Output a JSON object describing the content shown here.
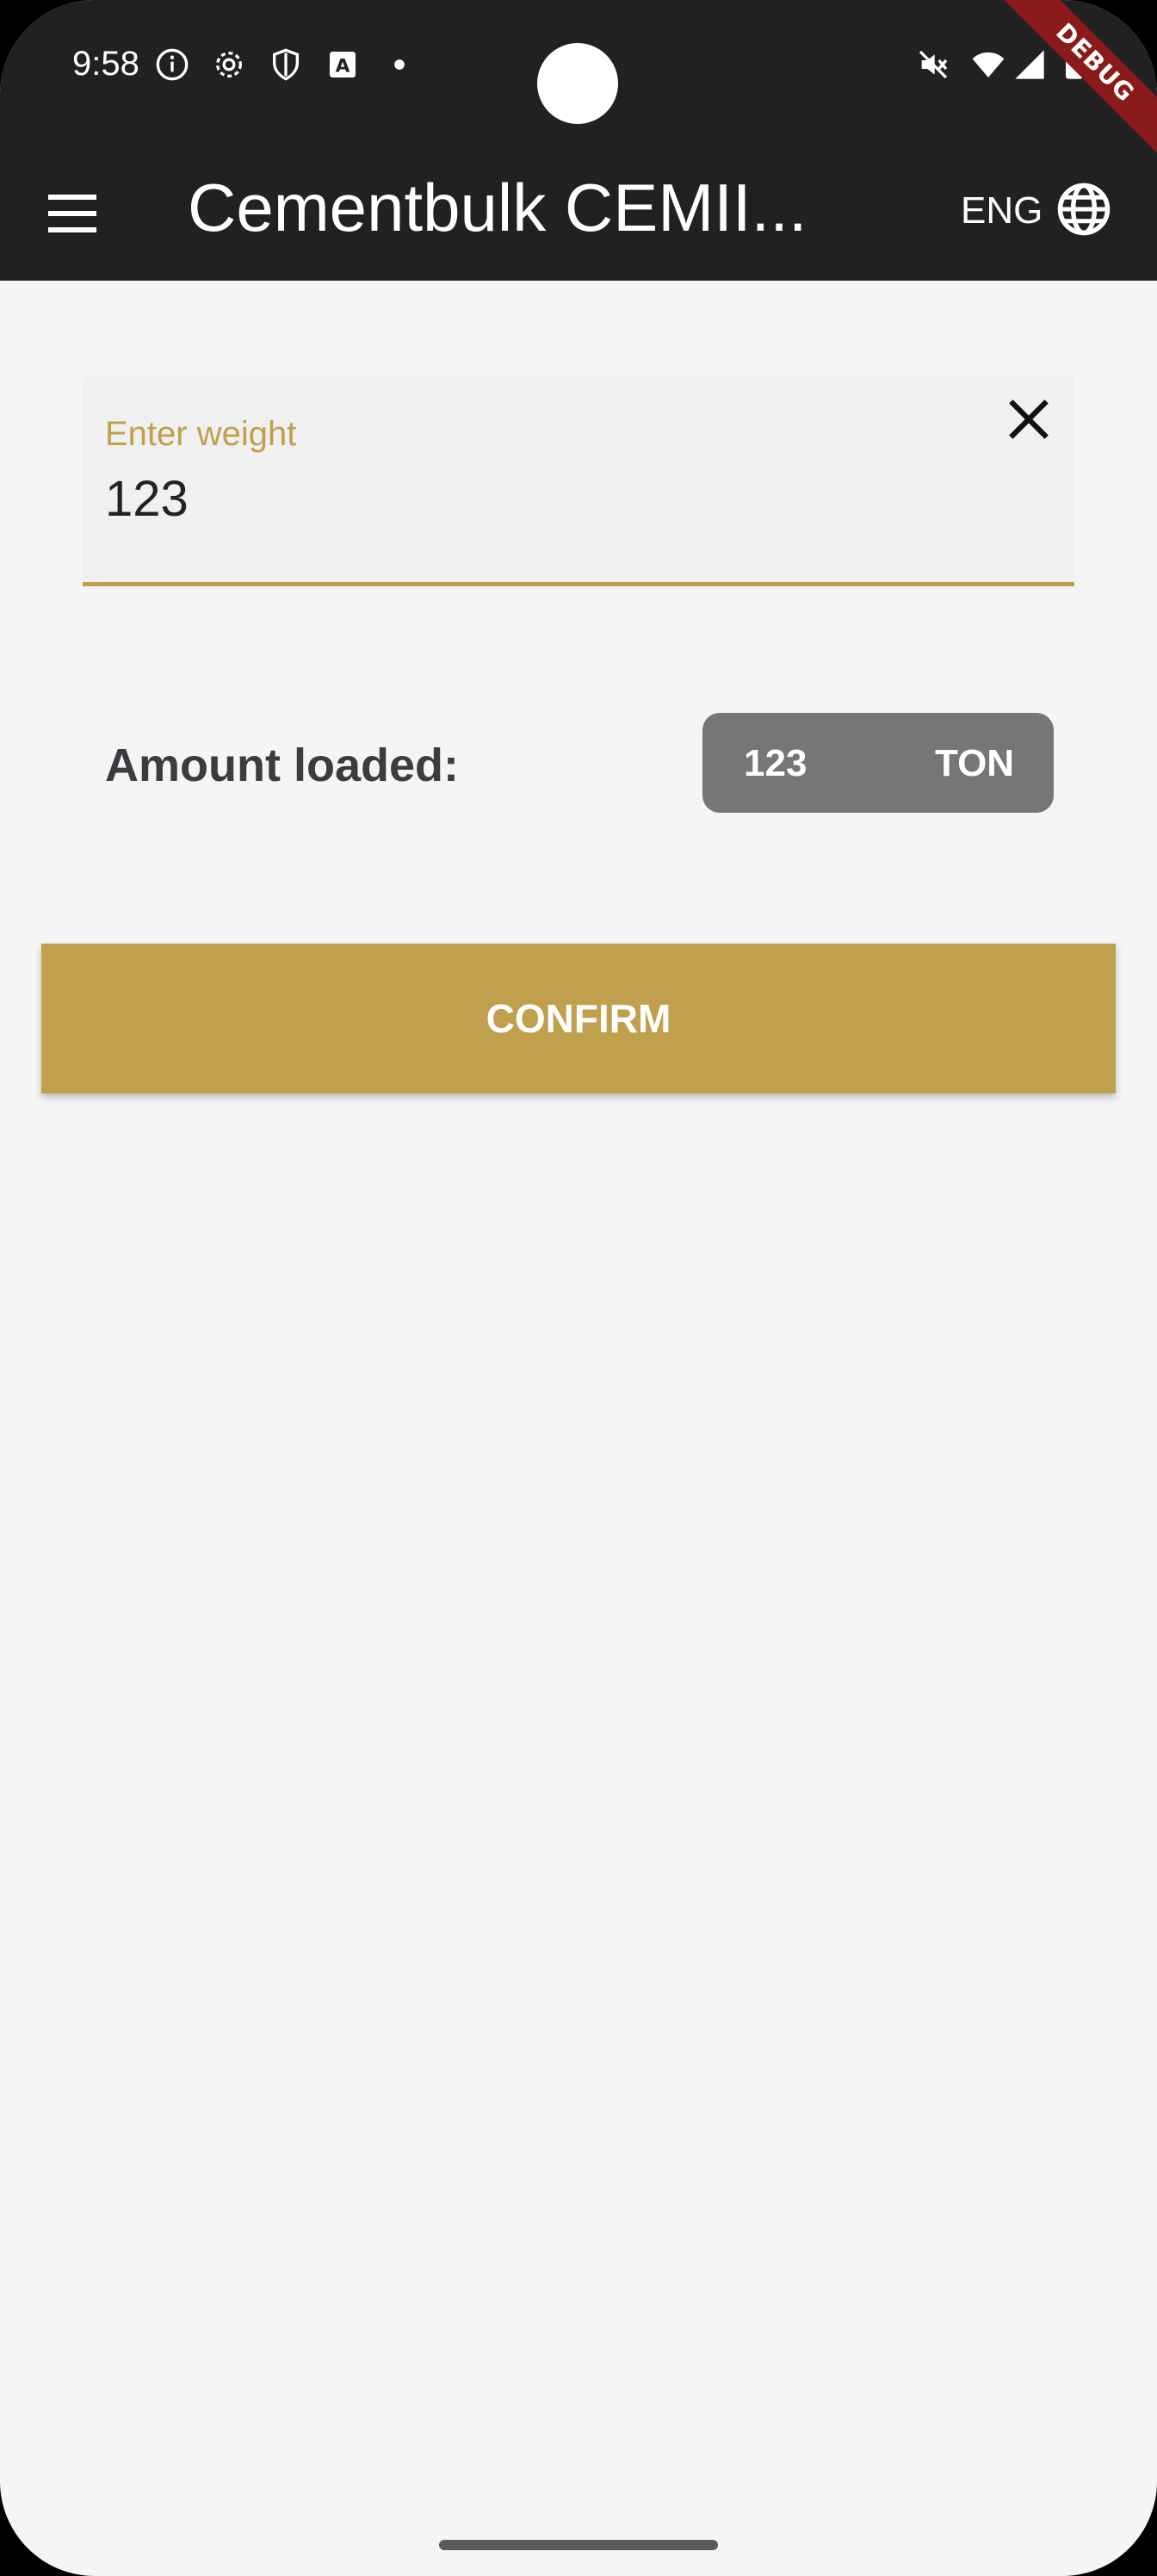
{
  "status_bar": {
    "time": "9:58",
    "icons": [
      "info-icon",
      "settings-icon",
      "shield-icon",
      "a-icon",
      "dot-icon",
      "mute-icon",
      "wifi-icon",
      "signal-icon",
      "battery-icon"
    ],
    "debug_banner": "DEBUG"
  },
  "app_bar": {
    "title": "Cementbulk CEMII...",
    "language": "ENG"
  },
  "weight_field": {
    "label": "Enter weight",
    "value": "123"
  },
  "amount": {
    "label": "Amount loaded:",
    "value": "123",
    "unit": "TON"
  },
  "confirm_button": {
    "label": "CONFIRM"
  },
  "colors": {
    "accent": "#c0a04c",
    "app_bar": "#212121",
    "pill": "#767676",
    "background": "#f5f5f5"
  }
}
